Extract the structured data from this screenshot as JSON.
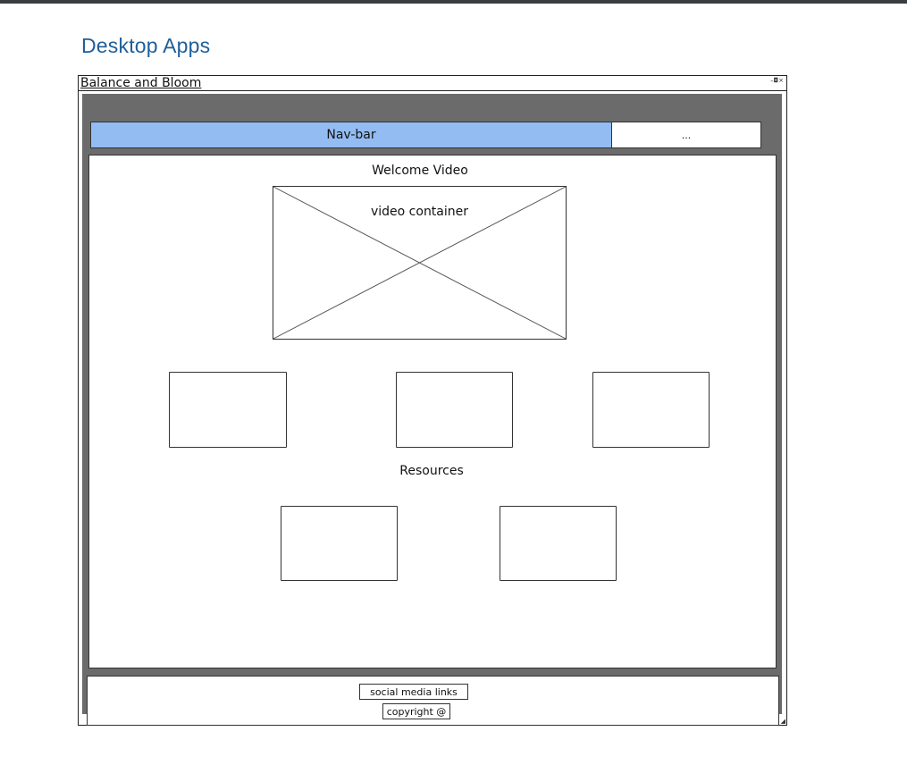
{
  "page_title": "Desktop Apps",
  "window": {
    "title": "Balance and Bloom",
    "controls": "–◘×"
  },
  "nav": {
    "bar_label": "Nav-bar",
    "more_label": "..."
  },
  "welcome": {
    "title": "Welcome Video",
    "video_label": "video container"
  },
  "resources": {
    "title": "Resources"
  },
  "footer": {
    "social_label": "social media links",
    "copyright_label": "copyright @"
  },
  "colors": {
    "topbar": "#3a3d40",
    "page_title": "#1f5f99",
    "navbar": "#93bcf2",
    "frame": "#6b6b6b"
  }
}
